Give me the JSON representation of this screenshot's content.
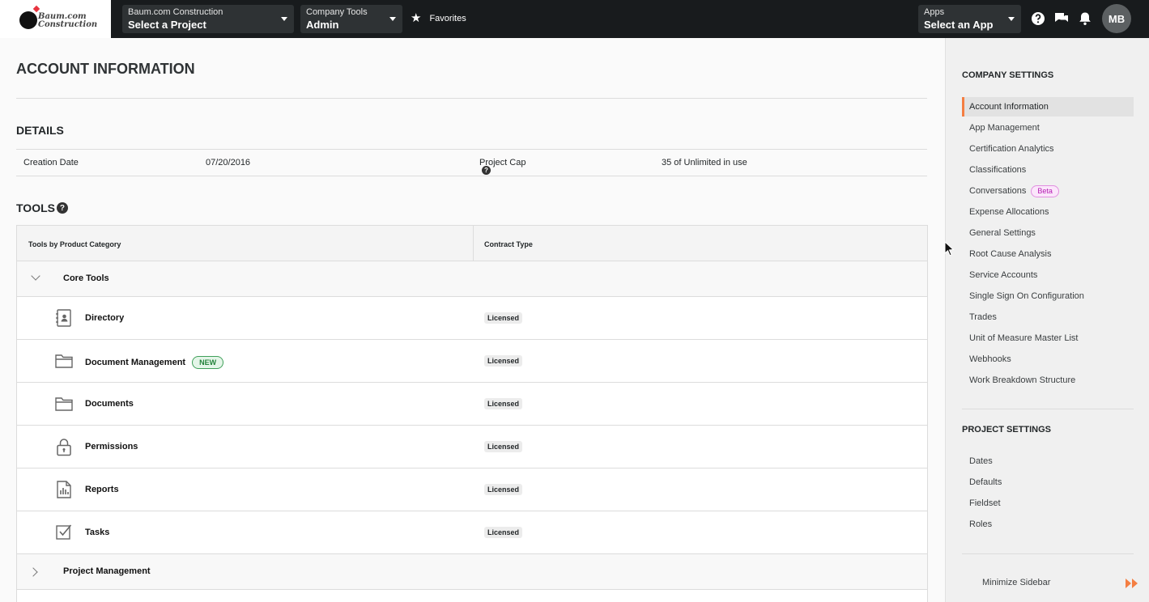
{
  "topbar": {
    "logo": {
      "line1": "Baum.com",
      "line2": "Construction"
    },
    "project_selector": {
      "label": "Baum.com Construction",
      "value": "Select a Project"
    },
    "tools_selector": {
      "label": "Company Tools",
      "value": "Admin"
    },
    "favorites_label": "Favorites",
    "apps_selector": {
      "label": "Apps",
      "value": "Select an App"
    },
    "avatar_initials": "MB"
  },
  "main": {
    "page_title": "ACCOUNT INFORMATION",
    "details": {
      "title": "DETAILS",
      "creation_date_label": "Creation Date",
      "creation_date_value": "07/20/2016",
      "project_cap_label": "Project Cap",
      "project_cap_value": "35 of Unlimited in use"
    },
    "tools": {
      "title": "TOOLS",
      "col_category": "Tools by Product Category",
      "col_contract": "Contract Type",
      "groups": [
        {
          "label": "Core Tools",
          "expanded": true,
          "items": [
            {
              "label": "Directory",
              "icon": "directory-icon",
              "contract": "Licensed"
            },
            {
              "label": "Document Management",
              "icon": "folder-icon",
              "badge": "NEW",
              "contract": "Licensed"
            },
            {
              "label": "Documents",
              "icon": "folder-icon",
              "contract": "Licensed"
            },
            {
              "label": "Permissions",
              "icon": "lock-icon",
              "contract": "Licensed"
            },
            {
              "label": "Reports",
              "icon": "report-icon",
              "contract": "Licensed"
            },
            {
              "label": "Tasks",
              "icon": "task-check-icon",
              "contract": "Licensed"
            }
          ]
        },
        {
          "label": "Project Management",
          "expanded": false
        }
      ]
    }
  },
  "sidebar": {
    "company_title": "COMPANY SETTINGS",
    "company_items": [
      {
        "label": "Account Information",
        "active": true
      },
      {
        "label": "App Management"
      },
      {
        "label": "Certification Analytics"
      },
      {
        "label": "Classifications"
      },
      {
        "label": "Conversations",
        "badge": "Beta"
      },
      {
        "label": "Expense Allocations"
      },
      {
        "label": "General Settings"
      },
      {
        "label": "Root Cause Analysis"
      },
      {
        "label": "Service Accounts"
      },
      {
        "label": "Single Sign On Configuration"
      },
      {
        "label": "Trades"
      },
      {
        "label": "Unit of Measure Master List"
      },
      {
        "label": "Webhooks"
      },
      {
        "label": "Work Breakdown Structure"
      }
    ],
    "project_title": "PROJECT SETTINGS",
    "project_items": [
      {
        "label": "Dates"
      },
      {
        "label": "Defaults"
      },
      {
        "label": "Fieldset"
      },
      {
        "label": "Roles"
      }
    ],
    "minimize_label": "Minimize Sidebar"
  },
  "colors": {
    "topbar_bg": "#181b1d",
    "active_accent": "#f47e42",
    "new_badge": "#24823b",
    "beta_badge": "#b51db2"
  }
}
